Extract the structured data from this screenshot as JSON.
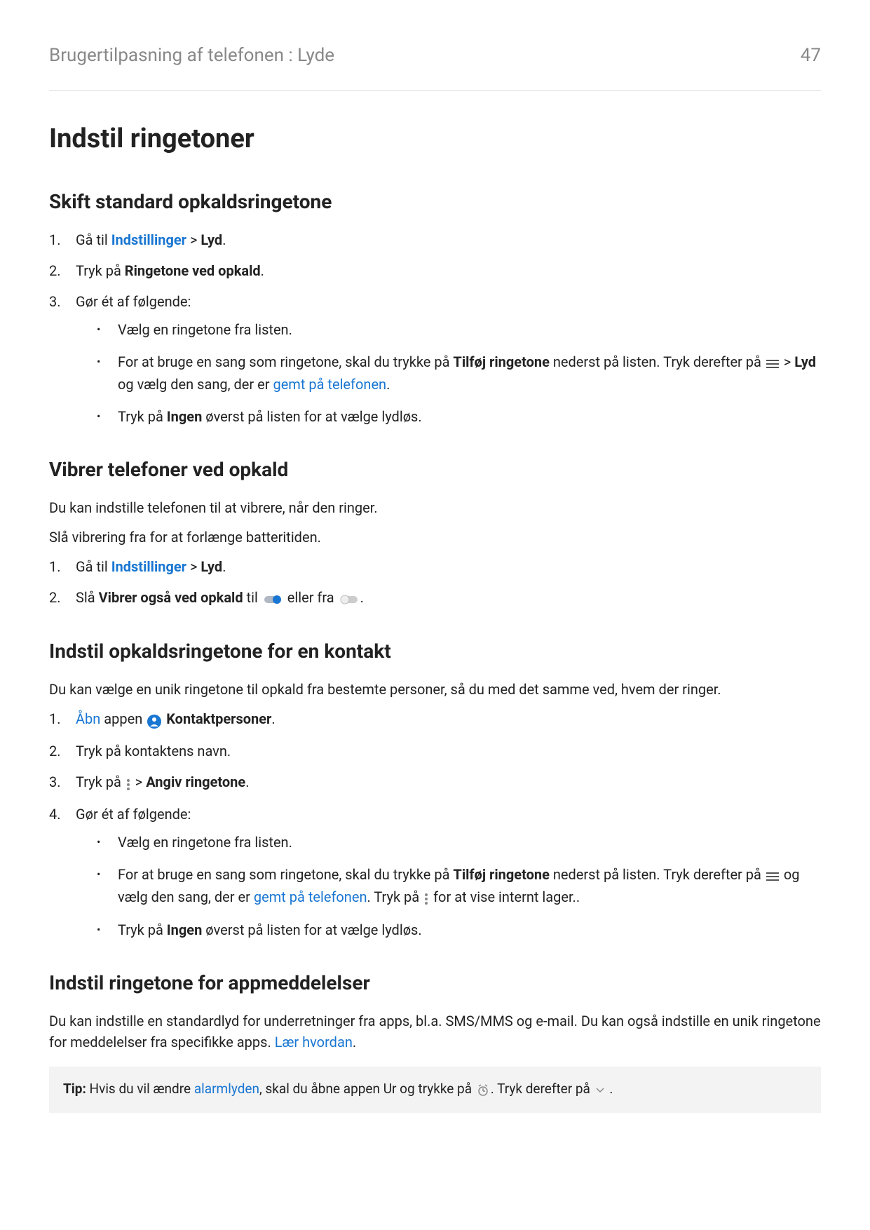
{
  "header": {
    "breadcrumb": "Brugertilpasning af telefonen : Lyde",
    "page": "47"
  },
  "h1": "Indstil ringetoner",
  "section1": {
    "heading": "Skift standard opkaldsringetone",
    "step1_pre": "Gå til ",
    "step1_link": "Indstillinger",
    "step1_sep": " > ",
    "step1_bold": "Lyd",
    "step1_end": ".",
    "step2_pre": "Tryk på ",
    "step2_bold": "Ringetone ved opkald",
    "step2_end": ".",
    "step3": "Gør ét af følgende:",
    "bullet1": "Vælg en ringetone fra listen.",
    "bullet2_pre": "For at bruge en sang som ringetone, skal du trykke på ",
    "bullet2_bold1": "Tilføj ringetone",
    "bullet2_mid1": " nederst på listen. Tryk derefter på ",
    "bullet2_sep": " > ",
    "bullet2_bold2": "Lyd",
    "bullet2_mid2": " og vælg den sang, der er ",
    "bullet2_link": "gemt på telefonen",
    "bullet2_end": ".",
    "bullet3_pre": "Tryk på ",
    "bullet3_bold": "Ingen",
    "bullet3_end": " øverst på listen for at vælge lydløs."
  },
  "section2": {
    "heading": "Vibrer telefoner ved opkald",
    "p1": "Du kan indstille telefonen til at vibrere, når den ringer.",
    "p2": "Slå vibrering fra for at forlænge batteritiden.",
    "step1_pre": "Gå til ",
    "step1_link": "Indstillinger",
    "step1_sep": " > ",
    "step1_bold": "Lyd",
    "step1_end": ".",
    "step2_pre": "Slå ",
    "step2_bold": "Vibrer også ved opkald",
    "step2_mid1": " til ",
    "step2_mid2": " eller fra ",
    "step2_end": "."
  },
  "section3": {
    "heading": "Indstil opkaldsringetone for en kontakt",
    "p1": "Du kan vælge en unik ringetone til opkald fra bestemte personer, så du med det samme ved, hvem der ringer.",
    "step1_link": "Åbn",
    "step1_mid": " appen ",
    "step1_bold": "Kontaktpersoner",
    "step1_end": ".",
    "step2": "Tryk på kontaktens navn.",
    "step3_pre": "Tryk på ",
    "step3_sep": " > ",
    "step3_bold": "Angiv ringetone",
    "step3_end": ".",
    "step4": "Gør ét af følgende:",
    "bullet1": "Vælg en ringetone fra listen.",
    "bullet2_pre": "For at bruge en sang som ringetone, skal du trykke på ",
    "bullet2_bold": "Tilføj ringetone",
    "bullet2_mid1": " nederst på listen. Tryk derefter på ",
    "bullet2_mid2": " og vælg den sang, der er ",
    "bullet2_link": "gemt på telefonen",
    "bullet2_mid3": ". Tryk på ",
    "bullet2_end": " for at vise internt lager..",
    "bullet3_pre": "Tryk på ",
    "bullet3_bold": "Ingen",
    "bullet3_end": " øverst på listen for at vælge lydløs."
  },
  "section4": {
    "heading": "Indstil ringetone for appmeddelelser",
    "p1_pre": "Du kan indstille en standardlyd for underretninger fra apps, bl.a. SMS/MMS og e-mail. Du kan også indstille en unik ringetone for meddelelser fra specifikke apps. ",
    "p1_link": "Lær hvordan",
    "p1_end": "."
  },
  "tip": {
    "label": "Tip:",
    "pre": " Hvis du vil ændre ",
    "link": "alarmlyden",
    "mid": ", skal du åbne appen Ur og trykke på ",
    "mid2": ". Tryk derefter på ",
    "end": " ."
  }
}
